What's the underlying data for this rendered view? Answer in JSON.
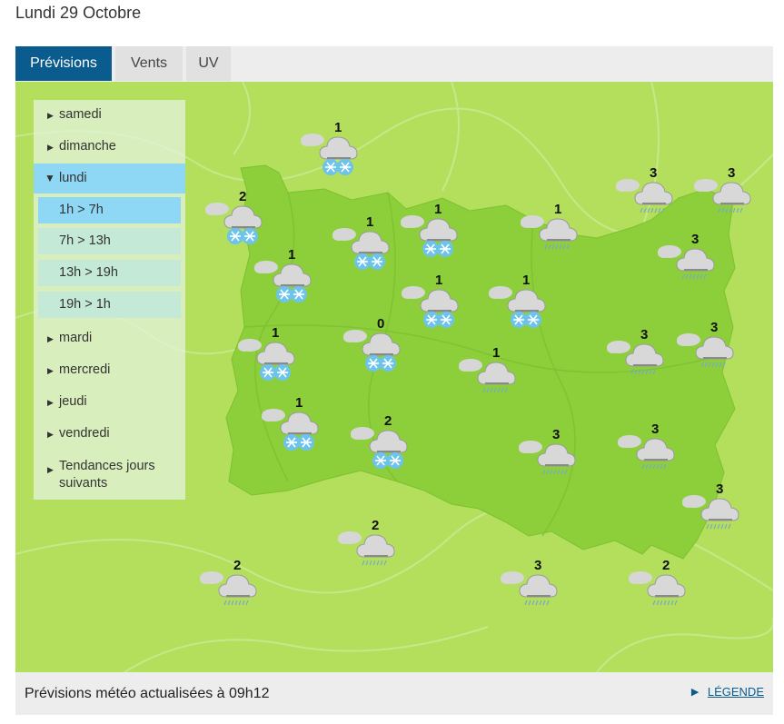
{
  "page": {
    "date_title": "Lundi 29 Octobre"
  },
  "tabs": [
    {
      "label": "Prévisions"
    },
    {
      "label": "Vents"
    },
    {
      "label": "UV"
    }
  ],
  "sidebar": {
    "days": [
      {
        "label": "samedi"
      },
      {
        "label": "dimanche"
      },
      {
        "label": "lundi"
      },
      {
        "label": "mardi"
      },
      {
        "label": "mercredi"
      },
      {
        "label": "jeudi"
      },
      {
        "label": "vendredi"
      },
      {
        "label": "Tendances jours suivants"
      }
    ],
    "periods": [
      {
        "label": "1h > 7h"
      },
      {
        "label": "7h > 13h"
      },
      {
        "label": "13h > 19h"
      },
      {
        "label": "19h > 1h"
      }
    ],
    "selected_day": "lundi",
    "selected_period": "1h > 7h"
  },
  "forecasts": [
    {
      "value": "1",
      "icon": "snow-cloud-icon"
    },
    {
      "value": "2",
      "icon": "snow-cloud-icon"
    },
    {
      "value": "1",
      "icon": "snow-cloud-icon"
    },
    {
      "value": "1",
      "icon": "snow-cloud-icon"
    },
    {
      "value": "1",
      "icon": "rain-cloud-icon"
    },
    {
      "value": "3",
      "icon": "rain-cloud-icon"
    },
    {
      "value": "3",
      "icon": "rain-cloud-icon"
    },
    {
      "value": "1",
      "icon": "snow-cloud-icon"
    },
    {
      "value": "3",
      "icon": "rain-cloud-icon"
    },
    {
      "value": "1",
      "icon": "snow-cloud-icon"
    },
    {
      "value": "1",
      "icon": "snow-cloud-icon"
    },
    {
      "value": "1",
      "icon": "snow-cloud-icon"
    },
    {
      "value": "0",
      "icon": "snow-cloud-icon"
    },
    {
      "value": "3",
      "icon": "rain-cloud-icon"
    },
    {
      "value": "3",
      "icon": "rain-cloud-icon"
    },
    {
      "value": "1",
      "icon": "rain-cloud-icon"
    },
    {
      "value": "1",
      "icon": "snow-cloud-icon"
    },
    {
      "value": "2",
      "icon": "snow-cloud-icon"
    },
    {
      "value": "3",
      "icon": "rain-cloud-icon"
    },
    {
      "value": "3",
      "icon": "rain-cloud-icon"
    },
    {
      "value": "3",
      "icon": "rain-cloud-icon"
    },
    {
      "value": "2",
      "icon": "rain-cloud-icon"
    },
    {
      "value": "2",
      "icon": "rain-cloud-icon"
    },
    {
      "value": "3",
      "icon": "rain-cloud-icon"
    },
    {
      "value": "2",
      "icon": "rain-cloud-icon"
    }
  ],
  "footer": {
    "text": "Prévisions météo actualisées à 09h12",
    "legend_label": "LÉGENDE"
  },
  "colors": {
    "tab_active": "#0a5c8f",
    "map_background": "#b3df5c",
    "region": "#8ccf3a",
    "snow": "#5ab8e6",
    "cloud": "#d4d4d4"
  }
}
